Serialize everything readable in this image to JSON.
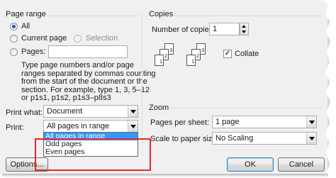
{
  "page_range": {
    "title": "Page range",
    "all": "All",
    "current_page": "Current page",
    "selection": "Selection",
    "pages": "Pages:",
    "pages_value": "",
    "help_text": [
      "Type page numbers and/or page",
      "ranges separated by commas counting",
      "from the start of the document or the",
      "section. For example, type 1, 3, 5–12",
      "or p1s1, p1s2, p1s3–p8s3"
    ]
  },
  "copies": {
    "title": "Copies",
    "number_label": "Number of copies:",
    "number_value": "1",
    "collate_label": "Collate",
    "collate_checked": true,
    "page_numbers": [
      "3",
      "2",
      "1",
      "3",
      "2",
      "1"
    ]
  },
  "print_what": {
    "label": "Print what:",
    "value": "Document"
  },
  "print": {
    "label": "Print:",
    "value": "All pages in range",
    "options": [
      "All pages in range",
      "Odd pages",
      "Even pages"
    ],
    "selected_index": 0
  },
  "zoom": {
    "title": "Zoom",
    "pages_per_sheet_label": "Pages per sheet:",
    "pages_per_sheet_value": "1 page",
    "scale_label": "Scale to paper size:",
    "scale_value": "No Scaling"
  },
  "buttons": {
    "options": "Options...",
    "ok": "OK",
    "cancel": "Cancel"
  },
  "colors": {
    "highlight": "#e8262a",
    "selected": "#3399ff"
  },
  "icons": {
    "checkmark": "check-icon",
    "dropdown": "chevron-down-icon"
  }
}
